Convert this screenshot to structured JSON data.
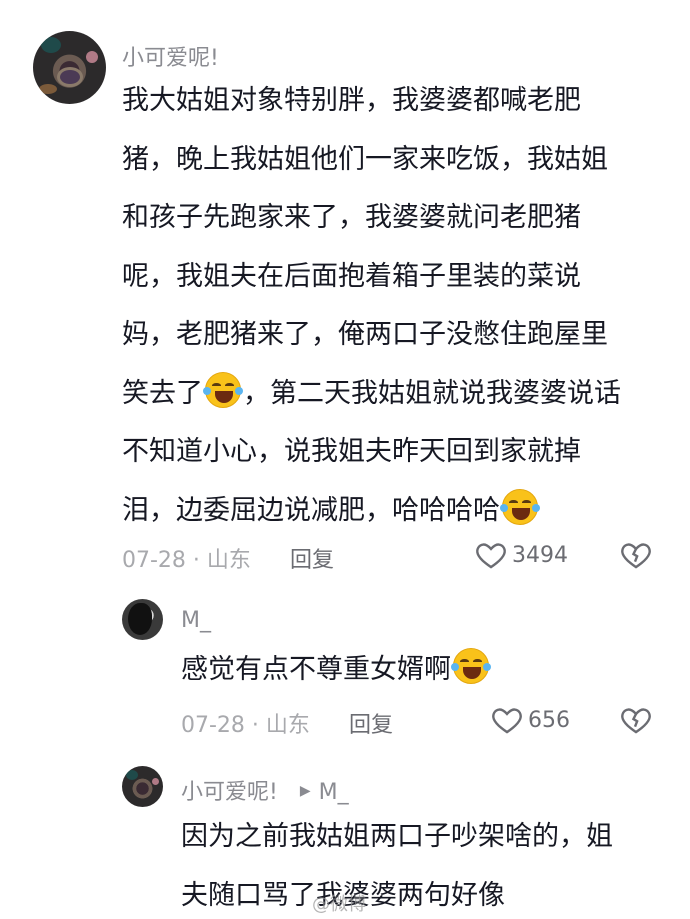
{
  "comments": [
    {
      "username": "小可爱呢!",
      "lines": [
        "我大姑姐对象特别胖，我婆婆都喊老肥",
        "猪，晚上我姑姐他们一家来吃饭，我姑姐",
        "和孩子先跑家来了，我婆婆就问老肥猪",
        "呢，我姐夫在后面抱着箱子里装的菜说",
        "妈，老肥猪来了，俺两口子没憋住跑屋里",
        "笑去了",
        "，第二天我姑姐就说我婆婆说话",
        "不知道小心，说我姐夫昨天回到家就掉",
        "泪，边委屈边说减肥，哈哈哈哈"
      ],
      "meta": "07-28 · 山东",
      "reply_label": "回复",
      "likes": "3494",
      "avatar_icon": "avatar-image",
      "emoji": "laughing-crying-emoji"
    },
    {
      "username": "M_",
      "text": "感觉有点不尊重女婿啊",
      "meta": "07-28 · 山东",
      "reply_label": "回复",
      "likes": "656"
    },
    {
      "username": "小可爱呢!",
      "reply_to": "M_",
      "lines": [
        "因为之前我姑姐两口子吵架啥的，姐",
        "夫随口骂了我婆婆两句好像"
      ]
    }
  ],
  "watermark": "@微博",
  "colors": {
    "text": "#161823",
    "meta": "#a8a9ad",
    "username": "#8a8b91"
  }
}
